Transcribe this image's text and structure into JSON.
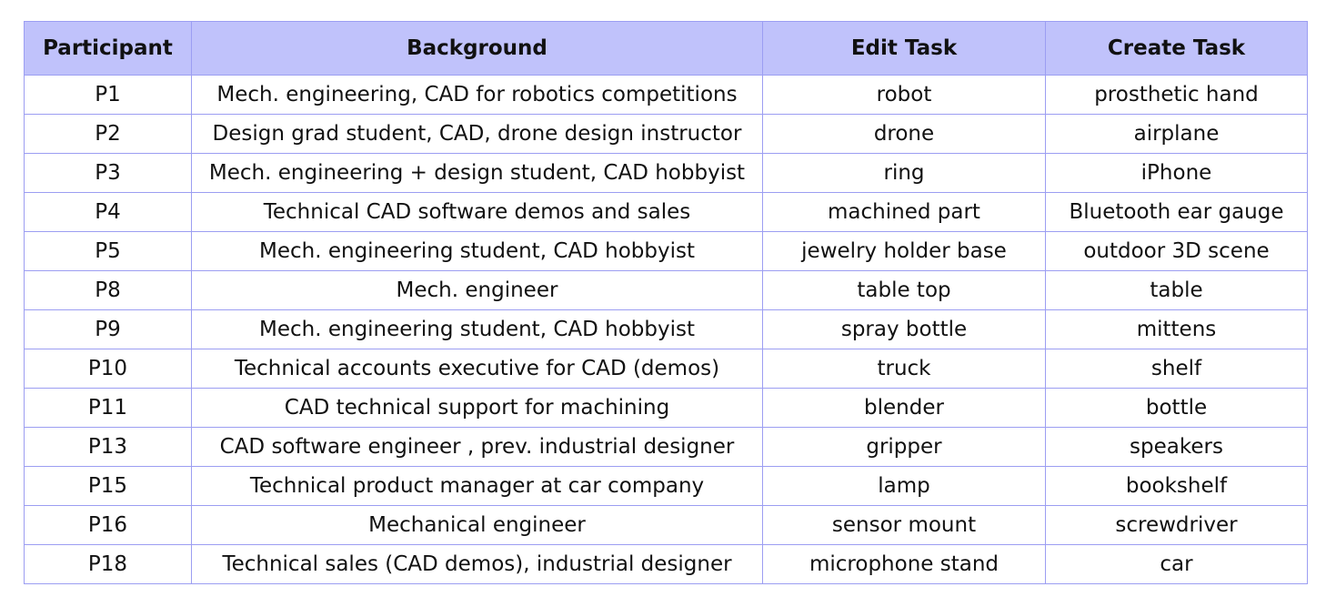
{
  "table": {
    "headers": [
      "Participant",
      "Background",
      "Edit Task",
      "Create Task"
    ],
    "rows": [
      [
        "P1",
        "Mech. engineering, CAD for robotics competitions",
        "robot",
        "prosthetic hand"
      ],
      [
        "P2",
        "Design grad student, CAD, drone design instructor",
        "drone",
        "airplane"
      ],
      [
        "P3",
        "Mech. engineering + design student, CAD hobbyist",
        "ring",
        "iPhone"
      ],
      [
        "P4",
        "Technical CAD software demos and sales",
        "machined part",
        "Bluetooth ear gauge"
      ],
      [
        "P5",
        "Mech. engineering student, CAD hobbyist",
        "jewelry holder base",
        "outdoor 3D scene"
      ],
      [
        "P8",
        "Mech. engineer",
        "table top",
        "table"
      ],
      [
        "P9",
        "Mech. engineering student, CAD hobbyist",
        "spray bottle",
        "mittens"
      ],
      [
        "P10",
        "Technical accounts executive for CAD (demos)",
        "truck",
        "shelf"
      ],
      [
        "P11",
        "CAD technical support for machining",
        "blender",
        "bottle"
      ],
      [
        "P13",
        "CAD software engineer , prev. industrial designer",
        "gripper",
        "speakers"
      ],
      [
        "P15",
        "Technical product manager at car company",
        "lamp",
        "bookshelf"
      ],
      [
        "P16",
        "Mechanical engineer",
        "sensor mount",
        "screwdriver"
      ],
      [
        "P18",
        "Technical sales (CAD demos), industrial designer",
        "microphone stand",
        "car"
      ]
    ]
  },
  "colors": {
    "header_background": "#c0c2fb",
    "border": "#9c9ef2",
    "text": "#111111"
  }
}
